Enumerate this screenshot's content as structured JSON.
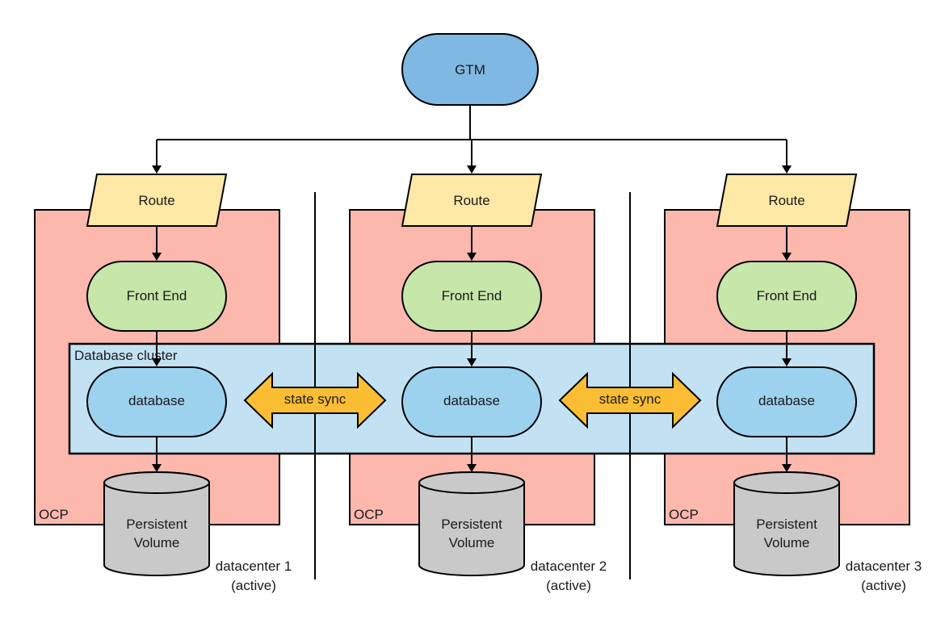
{
  "diagram": {
    "gtm": {
      "label": "GTM"
    },
    "database_cluster": {
      "label": "Database cluster"
    },
    "state_sync": [
      {
        "label": "state sync"
      },
      {
        "label": "state sync"
      }
    ],
    "datacenters": [
      {
        "route": "Route",
        "front_end": "Front End",
        "database": "database",
        "volume_line1": "Persistent",
        "volume_line2": "Volume",
        "platform": "OCP",
        "name": "datacenter 1",
        "status": "(active)"
      },
      {
        "route": "Route",
        "front_end": "Front End",
        "database": "database",
        "volume_line1": "Persistent",
        "volume_line2": "Volume",
        "platform": "OCP",
        "name": "datacenter 2",
        "status": "(active)"
      },
      {
        "route": "Route",
        "front_end": "Front End",
        "database": "database",
        "volume_line1": "Persistent",
        "volume_line2": "Volume",
        "platform": "OCP",
        "name": "datacenter 3",
        "status": "(active)"
      }
    ],
    "colors": {
      "gtm": "#7fb8e3",
      "route": "#fde8a6",
      "ocp": "#fdb8ae",
      "front_end": "#c7e6a9",
      "cluster": "#c2e2f4",
      "database": "#9dd2ef",
      "sync": "#fbbd34",
      "volume": "#c9c9c9"
    }
  }
}
